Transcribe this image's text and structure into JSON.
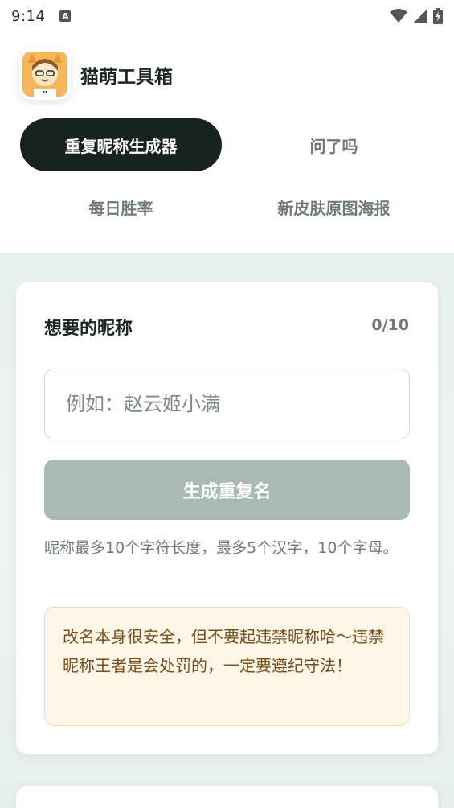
{
  "status_bar": {
    "time": "9:14",
    "notification_icon": "A"
  },
  "header": {
    "app_title": "猫萌工具箱",
    "tabs": [
      {
        "label": "重复昵称生成器",
        "active": true
      },
      {
        "label": "问了吗",
        "active": false
      },
      {
        "label": "每日胜率",
        "active": false
      },
      {
        "label": "新皮肤原图海报",
        "active": false
      }
    ]
  },
  "card": {
    "title": "想要的昵称",
    "count": "0/10",
    "input_placeholder": "例如：赵云姬小满",
    "input_value": "",
    "button_label": "生成重复名",
    "hint": "昵称最多10个字符长度，最多5个汉字，10个字母。",
    "notice": "改名本身很安全，但不要起违禁昵称哈～违禁昵称王者是会处罚的，一定要遵纪守法！"
  },
  "colors": {
    "active_tab": "#16221e",
    "button_disabled": "#a9bab5",
    "notice_bg": "#fef6e6",
    "notice_text": "#7a4e1c"
  }
}
